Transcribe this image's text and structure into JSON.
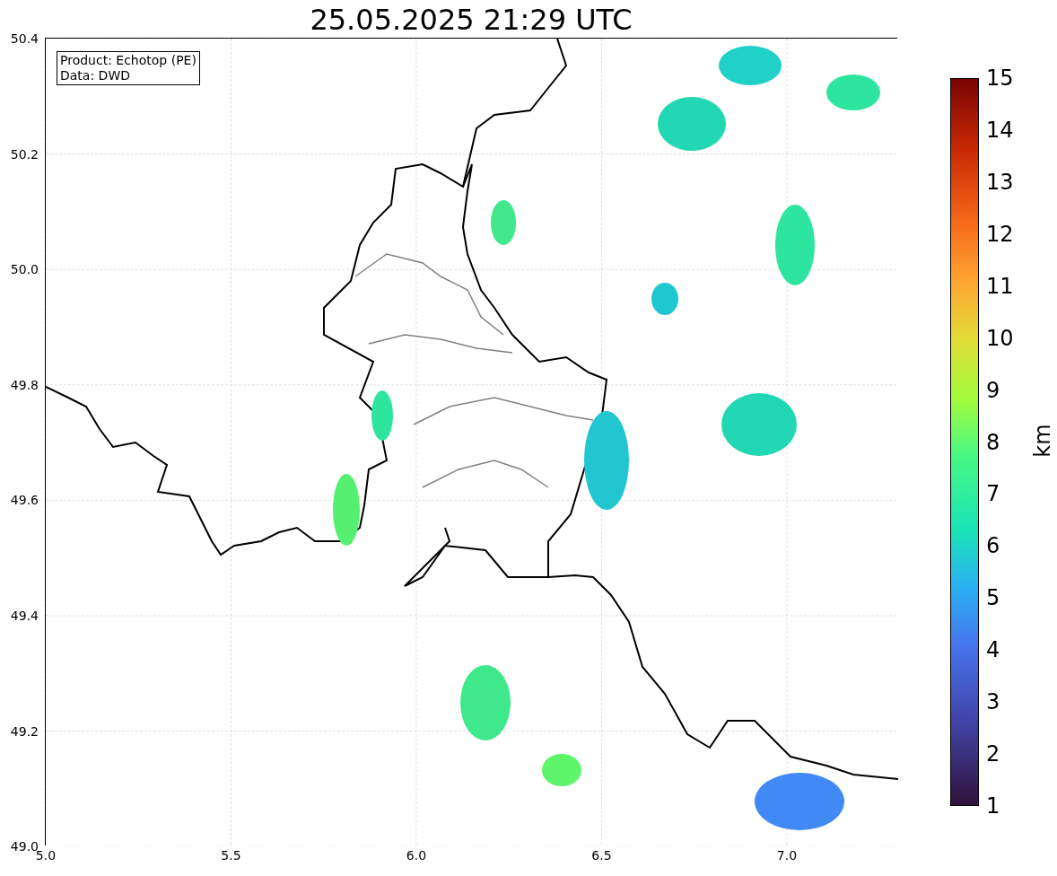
{
  "title": "25.05.2025 21:29 UTC",
  "map": {
    "info_lines": [
      "Product: Echotop (PE)",
      "Data: DWD"
    ],
    "x_ticks": [
      "5.0",
      "5.5",
      "6.0",
      "6.5",
      "7.0"
    ],
    "y_ticks": [
      "50.4",
      "50.2",
      "50.0",
      "49.8",
      "49.6",
      "49.4",
      "49.2",
      "49.0"
    ]
  },
  "colorbar": {
    "label": "km",
    "ticks": [
      "15",
      "14",
      "13",
      "12",
      "11",
      "10",
      "9",
      "8",
      "7",
      "6",
      "5",
      "4",
      "3",
      "2",
      "1"
    ]
  }
}
